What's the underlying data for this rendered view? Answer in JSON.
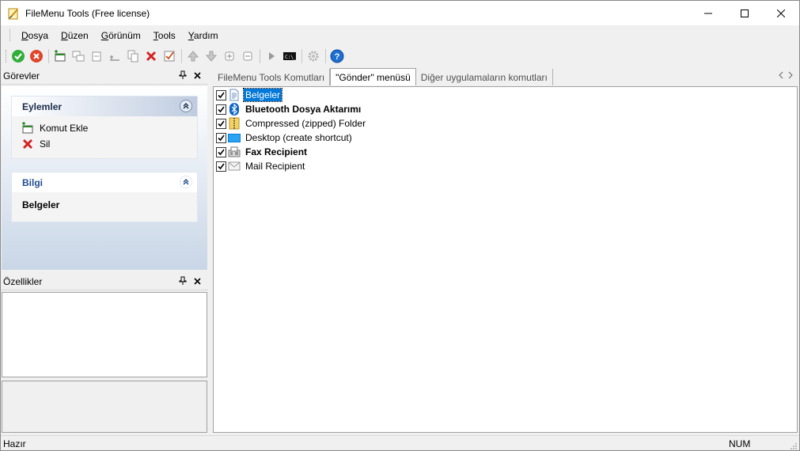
{
  "window": {
    "title": "FileMenu Tools (Free license)"
  },
  "menu": [
    {
      "accel": "D",
      "rest": "osya"
    },
    {
      "accel": "D",
      "rest": "üzen"
    },
    {
      "accel": "G",
      "rest": "örünüm"
    },
    {
      "accel": "T",
      "rest": "ools"
    },
    {
      "accel": "Y",
      "rest": "ardım"
    }
  ],
  "toolbar": {
    "icons": [
      "apply-icon",
      "cancel-icon",
      "add-command-icon",
      "add-submenu-icon",
      "add-separator-icon",
      "add-item-icon",
      "copy-icon",
      "delete-icon",
      "check-icon",
      "move-up-icon",
      "move-down-icon",
      "expand-icon",
      "collapse-icon",
      "run-icon",
      "console-icon",
      "settings-icon",
      "help-icon"
    ]
  },
  "tasks_pane": {
    "title": "Görevler",
    "actions_group": {
      "title": "Eylemler",
      "items": [
        "Komut Ekle",
        "Sil"
      ]
    },
    "info_group": {
      "title": "Bilgi",
      "value": "Belgeler"
    }
  },
  "properties_pane": {
    "title": "Özellikler"
  },
  "tabs": [
    {
      "label": "FileMenu Tools Komutları",
      "active": false
    },
    {
      "label": "\"Gönder\" menüsü",
      "active": true
    },
    {
      "label": "Diğer uygulamaların komutları",
      "active": false
    }
  ],
  "list": [
    {
      "label": "Belgeler",
      "checked": true,
      "bold": false,
      "selected": true,
      "icon": "documents-icon"
    },
    {
      "label": "Bluetooth Dosya Aktarımı",
      "checked": true,
      "bold": true,
      "selected": false,
      "icon": "bluetooth-icon"
    },
    {
      "label": "Compressed (zipped) Folder",
      "checked": true,
      "bold": false,
      "selected": false,
      "icon": "zip-folder-icon"
    },
    {
      "label": "Desktop (create shortcut)",
      "checked": true,
      "bold": false,
      "selected": false,
      "icon": "desktop-icon"
    },
    {
      "label": "Fax Recipient",
      "checked": true,
      "bold": true,
      "selected": false,
      "icon": "fax-icon"
    },
    {
      "label": "Mail Recipient",
      "checked": true,
      "bold": false,
      "selected": false,
      "icon": "mail-icon"
    }
  ],
  "status": {
    "left": "Hazır",
    "num": "NUM"
  }
}
